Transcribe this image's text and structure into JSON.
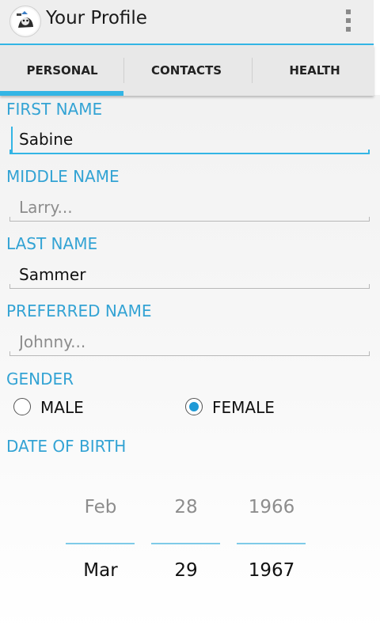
{
  "app": {
    "title": "Your Profile",
    "icon": "app-logo-icon",
    "overflow_icon": "overflow-menu-icon"
  },
  "tabs": [
    {
      "label": "PERSONAL",
      "selected": true
    },
    {
      "label": "CONTACTS",
      "selected": false
    },
    {
      "label": "HEALTH",
      "selected": false
    }
  ],
  "form": {
    "first_name": {
      "label": "FIRST NAME",
      "value": "Sabine",
      "placeholder": ""
    },
    "middle_name": {
      "label": "MIDDLE NAME",
      "value": "",
      "placeholder": "Larry..."
    },
    "last_name": {
      "label": "LAST NAME",
      "value": "Sammer",
      "placeholder": ""
    },
    "preferred_name": {
      "label": "PREFERRED NAME",
      "value": "",
      "placeholder": "Johnny..."
    },
    "gender": {
      "label": "GENDER",
      "options": [
        {
          "label": "MALE",
          "checked": false
        },
        {
          "label": "FEMALE",
          "checked": true
        }
      ]
    },
    "date_of_birth": {
      "label": "DATE OF BIRTH",
      "previous": {
        "month": "Feb",
        "day": "28",
        "year": "1966"
      },
      "selected": {
        "month": "Mar",
        "day": "29",
        "year": "1967"
      }
    }
  },
  "colors": {
    "accent": "#33b5e5",
    "label": "#33a3d4",
    "radio_checked": "#1f9ad6"
  }
}
